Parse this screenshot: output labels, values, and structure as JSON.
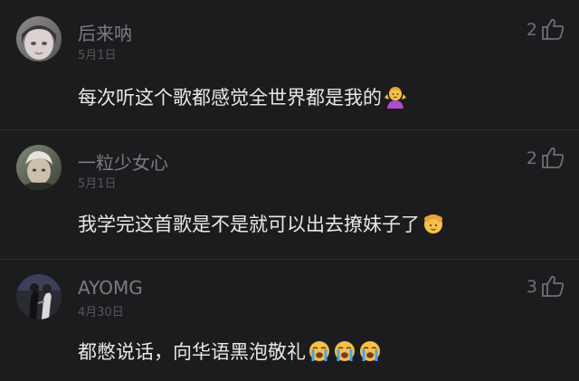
{
  "comments": [
    {
      "username": "后来呐",
      "date": "5月1日",
      "likes": "2",
      "text": "每次听这个歌都感觉全世界都是我的",
      "emojis": [
        "woman-shrugging-emoji"
      ]
    },
    {
      "username": "一粒少女心",
      "date": "5月1日",
      "likes": "2",
      "text": "我学完这首歌是不是就可以出去撩妹子了",
      "emojis": [
        "girl-face-emoji"
      ]
    },
    {
      "username": "AYOMG",
      "date": "4月30日",
      "likes": "3",
      "text": "都憋说话，向华语黑泡敬礼",
      "emojis": [
        "loudly-crying-face-emoji",
        "loudly-crying-face-emoji",
        "loudly-crying-face-emoji"
      ]
    }
  ],
  "icons": {
    "like": "thumbs-up-outline-icon"
  },
  "colors": {
    "background": "#1c1c1e",
    "username": "#7b7b80",
    "date": "#56565b",
    "text": "#e9e9eb"
  }
}
